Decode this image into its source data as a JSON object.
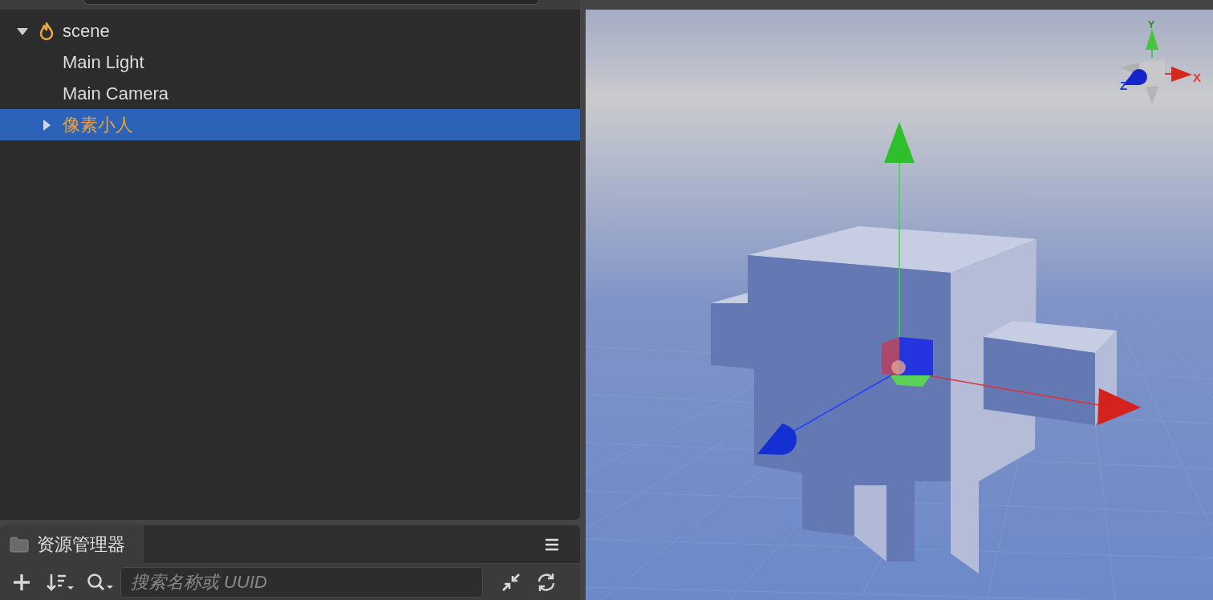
{
  "hierarchy": {
    "tree": [
      {
        "label": "scene",
        "selected": false,
        "expanded": true,
        "children": [
          {
            "label": "Main Light",
            "selected": false
          },
          {
            "label": "Main Camera",
            "selected": false
          },
          {
            "label": "像素小人",
            "selected": true,
            "expanded": false
          }
        ]
      }
    ]
  },
  "assets": {
    "tab_label": "资源管理器",
    "search": {
      "placeholder": "搜索名称或 UUID"
    }
  },
  "scene_view": {
    "axis_labels": [
      {
        "text": "Y"
      },
      {
        "text": "X"
      },
      {
        "text": "Z"
      }
    ]
  }
}
